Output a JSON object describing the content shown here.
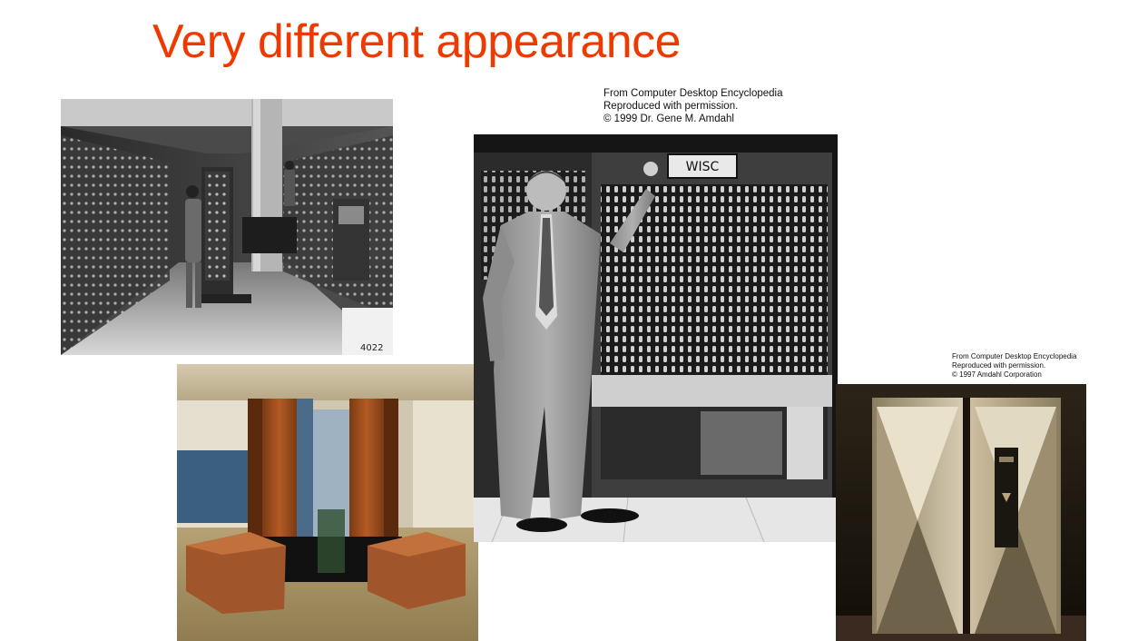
{
  "slide": {
    "title": "Very different appearance",
    "title_color": "#ee3a00"
  },
  "photos": {
    "eniac": {
      "label_number": "4022"
    },
    "wisc": {
      "panel_label": "WISC"
    }
  },
  "credits": {
    "wisc": {
      "line1": "From Computer Desktop Encyclopedia",
      "line2": "Reproduced with permission.",
      "line3": "© 1999 Dr. Gene M. Amdahl"
    },
    "amdahl": {
      "line1": "From Computer Desktop Encyclopedia",
      "line2": "Reproduced with permission.",
      "line3": "© 1997 Amdahl Corporation"
    }
  }
}
